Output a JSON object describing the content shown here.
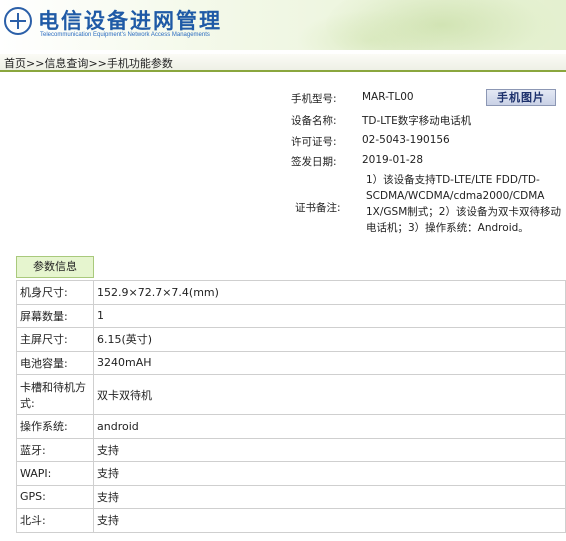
{
  "header": {
    "title": "电信设备进网管理",
    "subtitle": "Telecommunication Equipment's Network Access Managements"
  },
  "breadcrumb": {
    "home": "首页",
    "sep1": ">>",
    "info_query": "信息查询",
    "sep2": ">>",
    "current": "手机功能参数"
  },
  "device_info": {
    "model_label": "手机型号:",
    "model_value": "MAR-TL00",
    "photo_button": "手机图片",
    "name_label": "设备名称:",
    "name_value": "TD-LTE数字移动电话机",
    "license_label": "许可证号:",
    "license_value": "02-5043-190156",
    "issue_date_label": "签发日期:",
    "issue_date_value": "2019-01-28",
    "remark_label": "证书备注:",
    "remark_value": "1）该设备支持TD-LTE/LTE FDD/TD-SCDMA/WCDMA/cdma2000/CDMA 1X/GSM制式；2）该设备为双卡双待移动电话机；3）操作系统：Android。"
  },
  "params": {
    "header": "参数信息",
    "rows": [
      {
        "label": "机身尺寸:",
        "value": "152.9×72.7×7.4(mm)"
      },
      {
        "label": "屏幕数量:",
        "value": "1"
      },
      {
        "label": "主屏尺寸:",
        "value": "6.15(英寸)"
      },
      {
        "label": "电池容量:",
        "value": "3240mAH"
      },
      {
        "label": "卡槽和待机方式:",
        "value": "双卡双待机"
      },
      {
        "label": "操作系统:",
        "value": "android"
      },
      {
        "label": "蓝牙:",
        "value": "支持"
      },
      {
        "label": "WAPI:",
        "value": "支持"
      },
      {
        "label": "GPS:",
        "value": "支持"
      },
      {
        "label": "北斗:",
        "value": "支持"
      }
    ]
  },
  "colors": {
    "title_blue": "#1f5aa6",
    "header_green": "#e6f5cf",
    "accent_green": "#8aa63e"
  }
}
